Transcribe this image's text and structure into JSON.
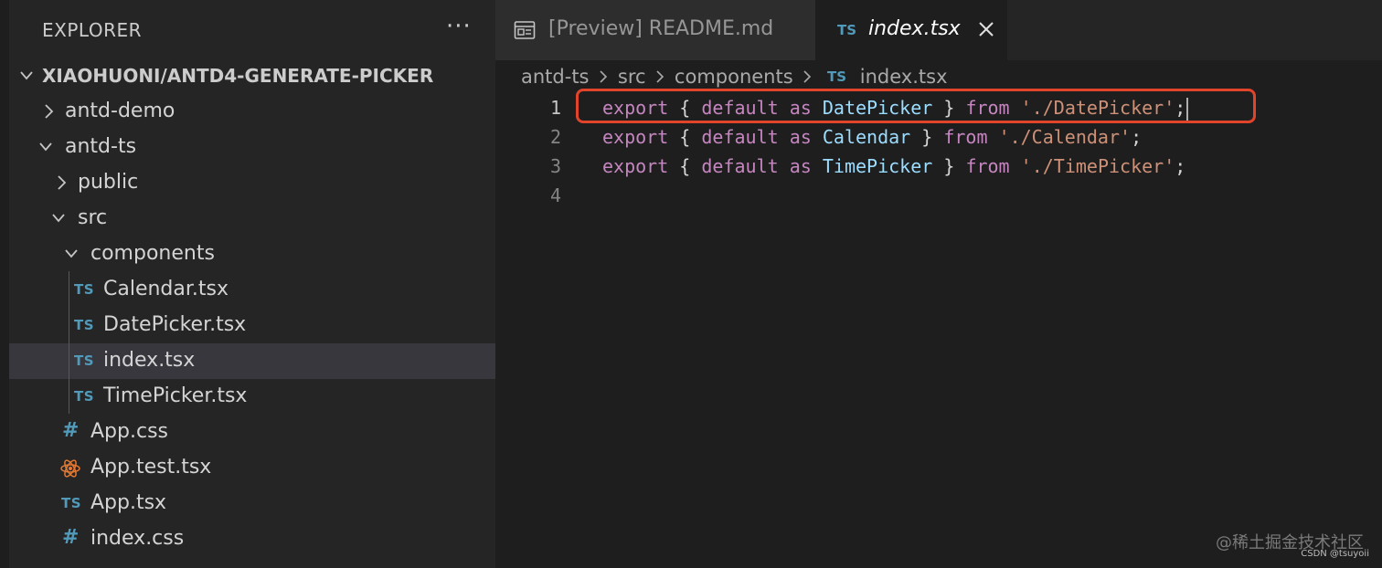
{
  "explorer": {
    "title": "EXPLORER",
    "more_actions": "···",
    "tree": [
      {
        "label": "XIAOHUONI/ANTD4-GENERATE-PICKER",
        "kind": "root-folder",
        "expanded": true
      },
      {
        "label": "antd-demo",
        "kind": "folder",
        "expanded": false
      },
      {
        "label": "antd-ts",
        "kind": "folder",
        "expanded": true
      },
      {
        "label": "public",
        "kind": "folder",
        "expanded": false
      },
      {
        "label": "src",
        "kind": "folder",
        "expanded": true
      },
      {
        "label": "components",
        "kind": "folder",
        "expanded": true
      },
      {
        "label": "Calendar.tsx",
        "kind": "file",
        "badge": "TS"
      },
      {
        "label": "DatePicker.tsx",
        "kind": "file",
        "badge": "TS"
      },
      {
        "label": "index.tsx",
        "kind": "file",
        "badge": "TS",
        "selected": true
      },
      {
        "label": "TimePicker.tsx",
        "kind": "file",
        "badge": "TS"
      },
      {
        "label": "App.css",
        "kind": "file",
        "badge": "#"
      },
      {
        "label": "App.test.tsx",
        "kind": "file",
        "badge": "react-icon"
      },
      {
        "label": "App.tsx",
        "kind": "file",
        "badge": "TS"
      },
      {
        "label": "index.css",
        "kind": "file",
        "badge": "#"
      }
    ]
  },
  "tabs": [
    {
      "label": "[Preview] README.md",
      "icon": "preview-icon",
      "active": false
    },
    {
      "label": "index.tsx",
      "icon": "TS",
      "active": true,
      "close": "close-icon"
    }
  ],
  "breadcrumb": {
    "items": [
      "antd-ts",
      "src",
      "components",
      "index.tsx"
    ],
    "file_badge": "TS"
  },
  "editor": {
    "current_line": 1,
    "highlighted_line": 1,
    "lines": [
      {
        "number": "1",
        "tokens": [
          {
            "t": "export",
            "c": "kw"
          },
          {
            "t": " ",
            "c": "punc"
          },
          {
            "t": "{",
            "c": "punc"
          },
          {
            "t": " ",
            "c": "punc"
          },
          {
            "t": "default",
            "c": "kw"
          },
          {
            "t": " ",
            "c": "punc"
          },
          {
            "t": "as",
            "c": "kw"
          },
          {
            "t": " ",
            "c": "punc"
          },
          {
            "t": "DatePicker",
            "c": "id"
          },
          {
            "t": " ",
            "c": "punc"
          },
          {
            "t": "}",
            "c": "punc"
          },
          {
            "t": " ",
            "c": "punc"
          },
          {
            "t": "from",
            "c": "kw"
          },
          {
            "t": " ",
            "c": "punc"
          },
          {
            "t": "'./DatePicker'",
            "c": "str"
          },
          {
            "t": ";",
            "c": "punc"
          }
        ]
      },
      {
        "number": "2",
        "tokens": [
          {
            "t": "export",
            "c": "kw"
          },
          {
            "t": " ",
            "c": "punc"
          },
          {
            "t": "{",
            "c": "punc"
          },
          {
            "t": " ",
            "c": "punc"
          },
          {
            "t": "default",
            "c": "kw"
          },
          {
            "t": " ",
            "c": "punc"
          },
          {
            "t": "as",
            "c": "kw"
          },
          {
            "t": " ",
            "c": "punc"
          },
          {
            "t": "Calendar",
            "c": "id"
          },
          {
            "t": " ",
            "c": "punc"
          },
          {
            "t": "}",
            "c": "punc"
          },
          {
            "t": " ",
            "c": "punc"
          },
          {
            "t": "from",
            "c": "kw"
          },
          {
            "t": " ",
            "c": "punc"
          },
          {
            "t": "'./Calendar'",
            "c": "str"
          },
          {
            "t": ";",
            "c": "punc"
          }
        ]
      },
      {
        "number": "3",
        "tokens": [
          {
            "t": "export",
            "c": "kw"
          },
          {
            "t": " ",
            "c": "punc"
          },
          {
            "t": "{",
            "c": "punc"
          },
          {
            "t": " ",
            "c": "punc"
          },
          {
            "t": "default",
            "c": "kw"
          },
          {
            "t": " ",
            "c": "punc"
          },
          {
            "t": "as",
            "c": "kw"
          },
          {
            "t": " ",
            "c": "punc"
          },
          {
            "t": "TimePicker",
            "c": "id"
          },
          {
            "t": " ",
            "c": "punc"
          },
          {
            "t": "}",
            "c": "punc"
          },
          {
            "t": " ",
            "c": "punc"
          },
          {
            "t": "from",
            "c": "kw"
          },
          {
            "t": " ",
            "c": "punc"
          },
          {
            "t": "'./TimePicker'",
            "c": "str"
          },
          {
            "t": ";",
            "c": "punc"
          }
        ]
      },
      {
        "number": "4",
        "tokens": []
      }
    ]
  },
  "colors": {
    "keyword": "#c586c0",
    "identifier": "#9cdcfe",
    "string": "#ce9178",
    "ts_badge": "#519aba",
    "highlight_box": "#e0442a"
  },
  "watermark": "@稀土掘金技术社区",
  "credit": "CSDN @tsuyoii"
}
